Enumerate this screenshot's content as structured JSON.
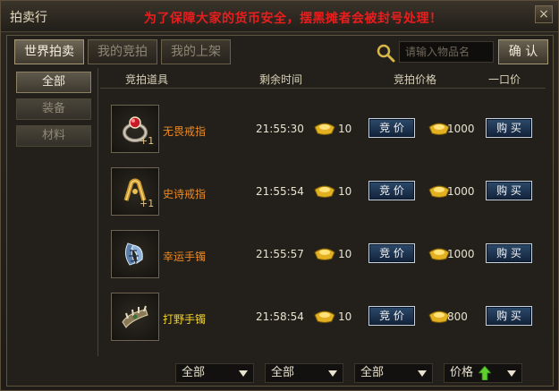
{
  "window": {
    "title": "拍卖行",
    "notice": "为了保障大家的货币安全，摆黑摊者会被封号处理！",
    "close_label": "×"
  },
  "tabs": [
    {
      "label": "世界拍卖",
      "active": true
    },
    {
      "label": "我的竞拍",
      "active": false
    },
    {
      "label": "我的上架",
      "active": false
    }
  ],
  "search": {
    "placeholder": "请输入物品名",
    "value": "",
    "confirm_label": "确 认"
  },
  "side_menu": [
    {
      "label": "全部",
      "active": true
    },
    {
      "label": "装备",
      "active": false
    },
    {
      "label": "材料",
      "active": false
    }
  ],
  "columns": {
    "item": "竞拍道具",
    "time": "剩余时间",
    "bid_price": "竞拍价格",
    "buyout": "一口价"
  },
  "items": [
    {
      "name": "无畏戒指",
      "name_color": "#f08a1e",
      "plus": "+1",
      "icon": "ruby-ring-icon",
      "time": "21:55:30",
      "bid": "10",
      "bid_label": "竞 价",
      "price": "1000",
      "buy_label": "购 买"
    },
    {
      "name": "史诗戒指",
      "name_color": "#f08a1e",
      "plus": "+1",
      "icon": "gold-ring-icon",
      "time": "21:55:54",
      "bid": "10",
      "bid_label": "竞 价",
      "price": "1000",
      "buy_label": "购 买"
    },
    {
      "name": "幸运手镯",
      "name_color": "#f08a1e",
      "plus": "",
      "icon": "crystal-bracelet-icon",
      "time": "21:55:57",
      "bid": "10",
      "bid_label": "竞 价",
      "price": "1000",
      "buy_label": "购 买"
    },
    {
      "name": "打野手镯",
      "name_color": "#f2d22a",
      "plus": "",
      "icon": "spiked-bracelet-icon",
      "time": "21:58:54",
      "bid": "10",
      "bid_label": "竞 价",
      "price": "800",
      "buy_label": "购 买"
    }
  ],
  "filters": [
    {
      "label": "全部"
    },
    {
      "label": "全部"
    },
    {
      "label": "全部"
    },
    {
      "label": "价格",
      "icon": "sort-up-arrow-icon"
    }
  ],
  "colors": {
    "accent_red": "#e81e1e",
    "item_orange": "#f08a1e",
    "item_yellow": "#f2d22a",
    "button_blue": "#1e3656"
  }
}
